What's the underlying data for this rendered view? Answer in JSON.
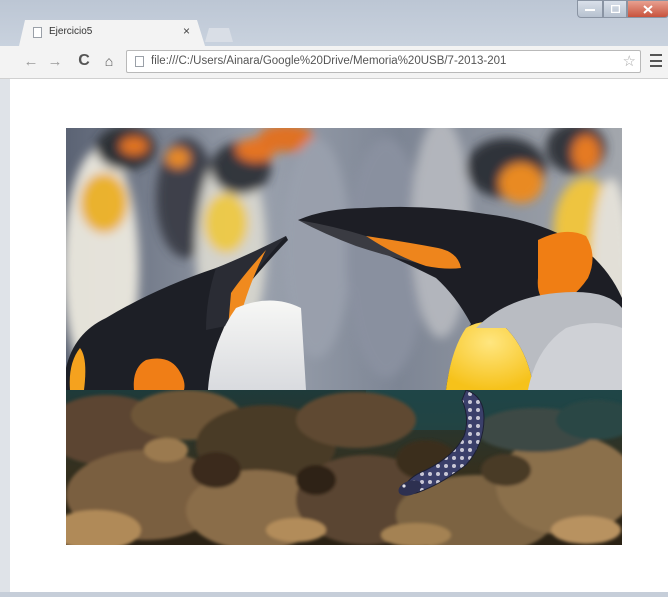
{
  "browser": {
    "tab": {
      "title": "Ejercicio5",
      "close_glyph": "×",
      "icon": "document-icon"
    },
    "window_controls": {
      "minimize": "minimize-icon",
      "maximize": "maximize-icon",
      "close": "close-icon"
    },
    "toolbar": {
      "back": "←",
      "forward": "→",
      "reload": "C",
      "home": "⌂",
      "url": "file:///C:/Users/Ainara/Google%20Drive/Memoria%20USB/7-2013-201",
      "bookmark_star": "☆"
    }
  },
  "page": {
    "images": [
      {
        "name": "king-penguins-photo",
        "subject": "king penguins"
      },
      {
        "name": "moray-eel-reef-photo",
        "subject": "moray eel on rocky reef"
      }
    ]
  },
  "colors": {
    "window_frame": "#c9d2de",
    "toolbar": "#f3f3f3",
    "close_button": "#c8533d",
    "penguin_orange": "#f08a1e"
  }
}
